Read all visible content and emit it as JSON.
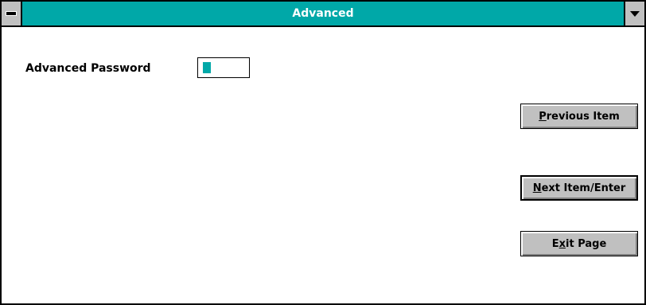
{
  "window": {
    "title": "Advanced"
  },
  "form": {
    "password_label": "Advanced Password",
    "password_value": ""
  },
  "buttons": {
    "previous": {
      "mnemonic": "P",
      "rest": "revious Item"
    },
    "next": {
      "mnemonic": "N",
      "rest": "ext Item/Enter"
    },
    "exit": {
      "pre": "E",
      "mnemonic": "x",
      "rest": "it Page"
    }
  },
  "colors": {
    "accent": "#00a8a8",
    "button_face": "#c0c0c0"
  },
  "icons": {
    "system_menu": "system-menu-icon",
    "minimize": "minimize-arrow-icon"
  }
}
